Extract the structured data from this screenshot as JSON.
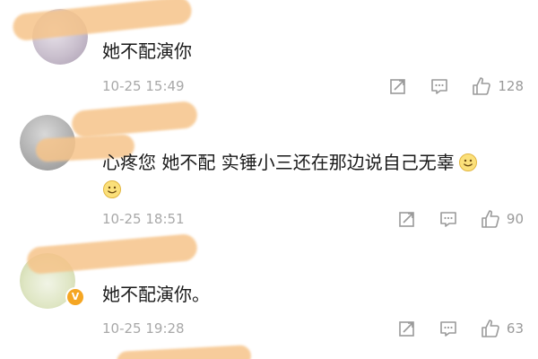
{
  "comments": [
    {
      "text": "她不配演你",
      "time": "10-25 15:49",
      "likes": "128",
      "has_emoji": false
    },
    {
      "text": "心疼您 她不配 实锤小三还在那边说自己无辜",
      "time": "10-25 18:51",
      "likes": "90",
      "has_emoji": true
    },
    {
      "text": "她不配演你。",
      "time": "10-25 19:28",
      "likes": "63",
      "has_emoji": false
    }
  ],
  "icons": {
    "share": "share-icon",
    "comment": "comment-icon",
    "like": "thumbs-up-icon",
    "emoji": "smile-emoji-icon",
    "badge": "verified-v-icon"
  },
  "colors": {
    "text": "#1a1a1a",
    "meta": "#a8a8a8",
    "redaction": "#f6c48a",
    "badge": "#f5a623"
  }
}
